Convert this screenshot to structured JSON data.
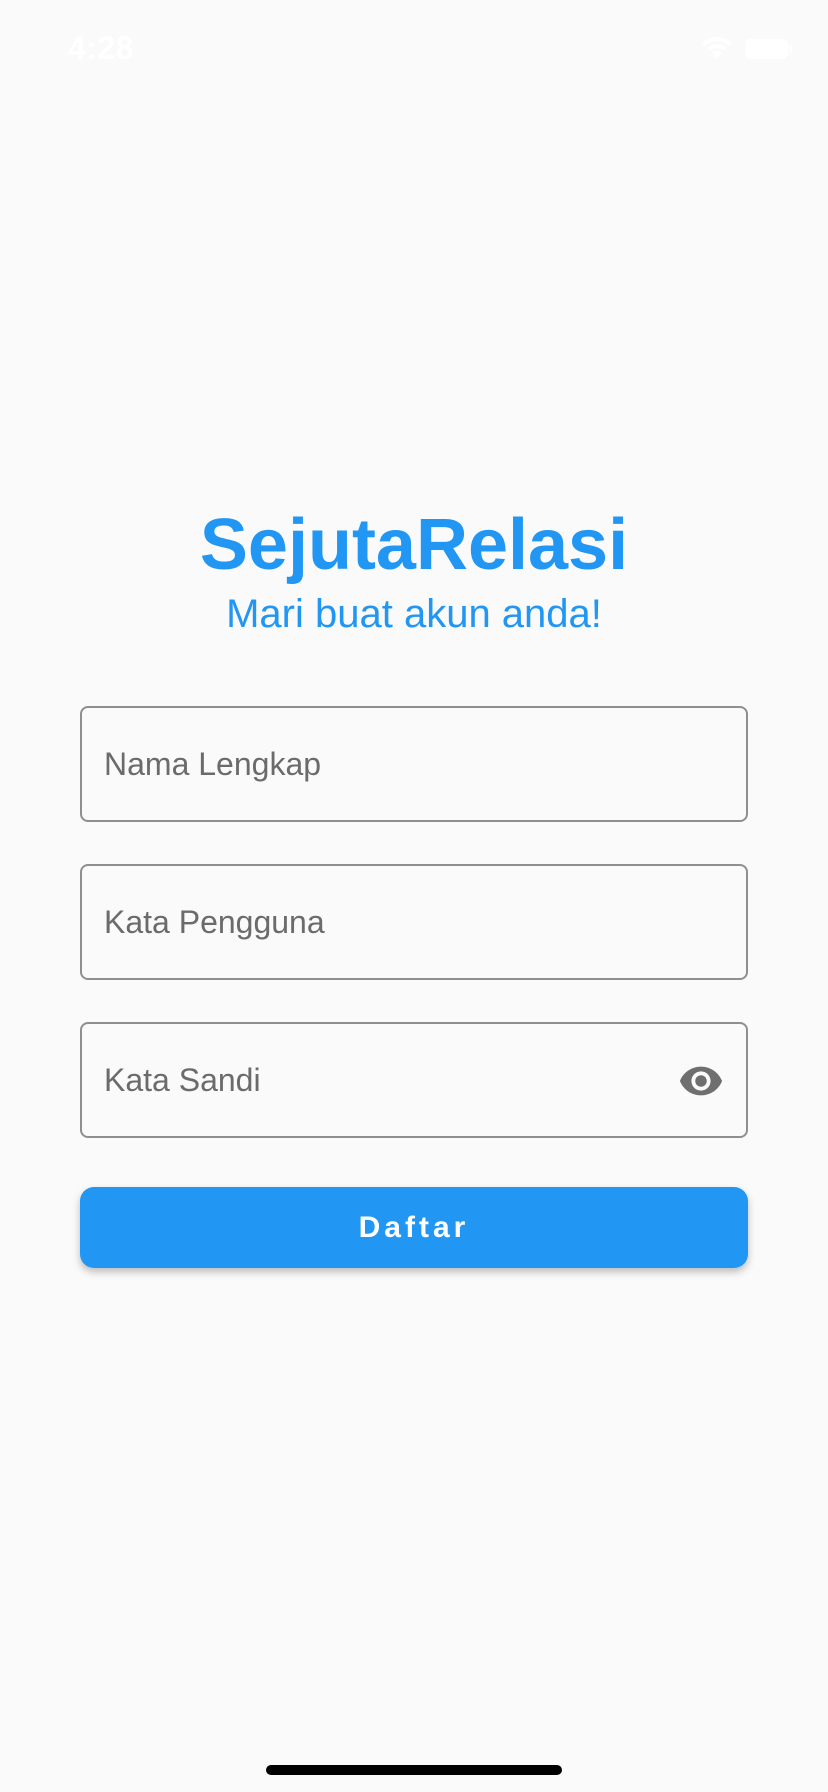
{
  "status_bar": {
    "time": "4:28",
    "icons": [
      "wifi-icon",
      "battery-icon"
    ]
  },
  "header": {
    "title": "SejutaRelasi",
    "subtitle": "Mari buat akun anda!"
  },
  "form": {
    "full_name": {
      "placeholder": "Nama Lengkap",
      "value": ""
    },
    "username": {
      "placeholder": "Kata Pengguna",
      "value": ""
    },
    "password": {
      "placeholder": "Kata Sandi",
      "value": "",
      "toggle_icon": "eye-icon"
    },
    "submit_label": "Daftar"
  },
  "colors": {
    "primary": "#2196f3",
    "background": "#fafafa",
    "field_border": "#8f8f8f",
    "placeholder": "#6b6b6b",
    "icon": "#6f6f6f"
  }
}
